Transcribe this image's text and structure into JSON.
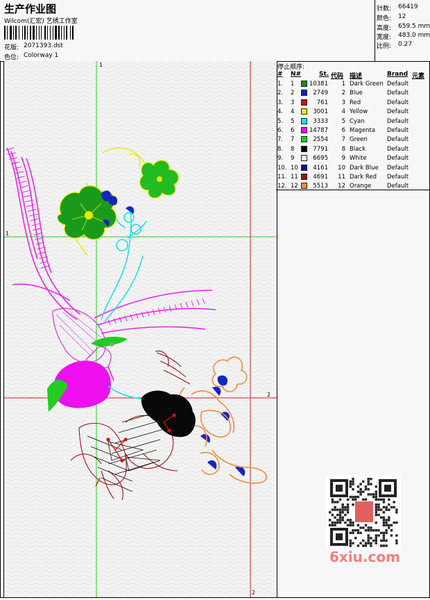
{
  "header": {
    "title": "生产作业图",
    "subtitle": "Wilcom(汇宏) 艺绣工作室",
    "design_label": "花版:",
    "design_value": "2071393.dst",
    "colorway_label": "色位:",
    "colorway_value": "Colorway 1"
  },
  "stats": [
    {
      "label": "针数:",
      "value": "66419"
    },
    {
      "label": "颜色:",
      "value": "12"
    },
    {
      "label": "高度:",
      "value": "659.5 mm"
    },
    {
      "label": "宽度:",
      "value": "483.0 mm"
    },
    {
      "label": "比例:",
      "value": "0.27"
    }
  ],
  "stop_sequence": {
    "title": "停止顺序:",
    "headers": {
      "idx": "#",
      "n": "N#",
      "st": "St.",
      "code": "代码",
      "desc": "描述",
      "brand": "Brand",
      "elem": "元素"
    },
    "rows": [
      {
        "idx": "1.",
        "n": "1",
        "color": "#1a8a1a",
        "st": "10381",
        "code": "1",
        "desc": "Dark Green",
        "brand": "Default"
      },
      {
        "idx": "2.",
        "n": "2",
        "color": "#1020c0",
        "st": "2749",
        "code": "2",
        "desc": "Blue",
        "brand": "Default"
      },
      {
        "idx": "3.",
        "n": "3",
        "color": "#d01010",
        "st": "761",
        "code": "3",
        "desc": "Red",
        "brand": "Default"
      },
      {
        "idx": "4.",
        "n": "4",
        "color": "#f0f000",
        "st": "3001",
        "code": "4",
        "desc": "Yellow",
        "brand": "Default"
      },
      {
        "idx": "5.",
        "n": "5",
        "color": "#10f0f0",
        "st": "3333",
        "code": "5",
        "desc": "Cyan",
        "brand": "Default"
      },
      {
        "idx": "6.",
        "n": "6",
        "color": "#f010f0",
        "st": "14787",
        "code": "6",
        "desc": "Magenta",
        "brand": "Default"
      },
      {
        "idx": "7.",
        "n": "7",
        "color": "#20d020",
        "st": "2554",
        "code": "7",
        "desc": "Green",
        "brand": "Default"
      },
      {
        "idx": "8.",
        "n": "8",
        "color": "#080808",
        "st": "7791",
        "code": "8",
        "desc": "Black",
        "brand": "Default"
      },
      {
        "idx": "9.",
        "n": "9",
        "color": "#f4f4f4",
        "st": "6695",
        "code": "9",
        "desc": "White",
        "brand": "Default"
      },
      {
        "idx": "10.",
        "n": "10",
        "color": "#1010a0",
        "st": "4161",
        "code": "10",
        "desc": "Dark Blue",
        "brand": "Default"
      },
      {
        "idx": "11.",
        "n": "11",
        "color": "#a01010",
        "st": "4691",
        "code": "11",
        "desc": "Dark Red",
        "brand": "Default"
      },
      {
        "idx": "12.",
        "n": "12",
        "color": "#f08c40",
        "st": "5513",
        "code": "12",
        "desc": "Orange",
        "brand": "Default"
      }
    ]
  },
  "canvas": {
    "axis_labels": {
      "top_1": "1",
      "left_1": "1",
      "right_2": "2",
      "bottom_2": "2"
    }
  },
  "watermark": "6xiu.com",
  "qr_stamp": "汇宏刺绣"
}
